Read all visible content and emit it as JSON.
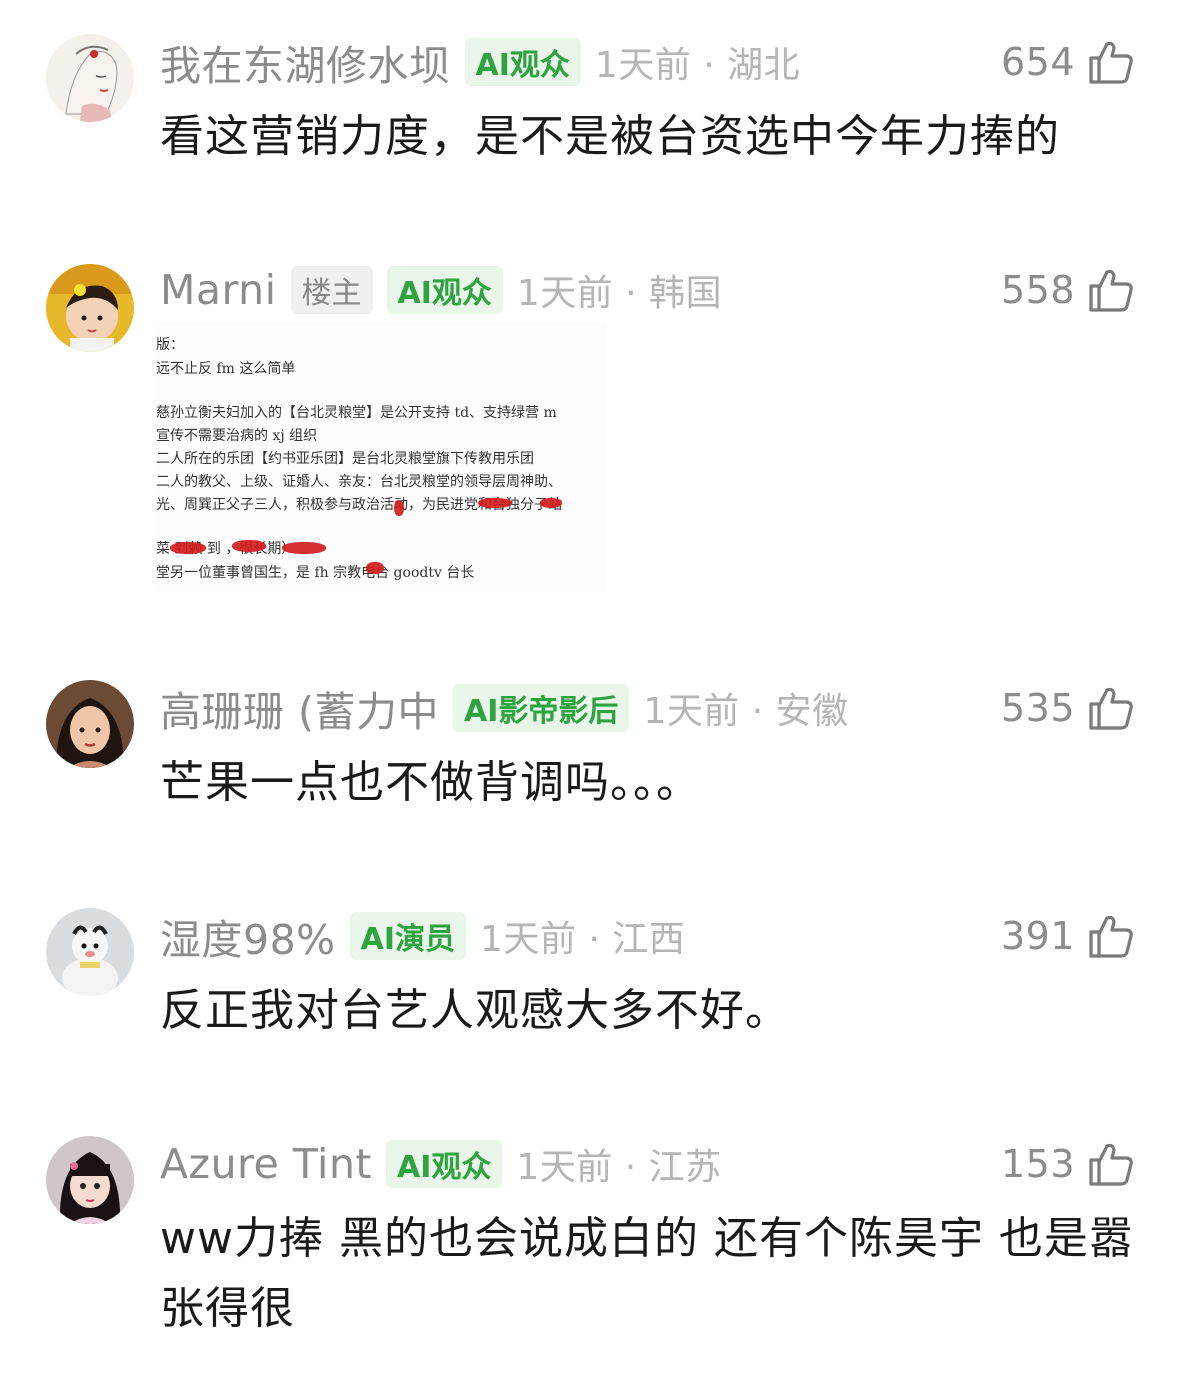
{
  "comments": [
    {
      "username": "我在东湖修水坝",
      "badges": [
        {
          "text": "AI观众",
          "type": "ai"
        }
      ],
      "time_location": "1天前 · 湖北",
      "likes": "654",
      "text": "看这营销力度，是不是被台资选中今年力捧的",
      "avatar": "avatar-sketch"
    },
    {
      "username": "Marni",
      "badges": [
        {
          "text": "楼主",
          "type": "host"
        },
        {
          "text": "AI观众",
          "type": "ai"
        }
      ],
      "time_location": "1天前 · 韩国",
      "likes": "558",
      "avatar": "avatar-child-yellow",
      "image_lines": [
        "版：",
        "远不止反 fm 这么简单",
        "慈孙立衡夫妇加入的【台北灵粮堂】是公开支持 td、支持绿营 m",
        "宣传不需要治病的 xj 组织",
        "二人所在的乐团【约书亚乐团】是台北灵粮堂旗下传教用乐团",
        "二人的教父、上级、证婚人、亲友：台北灵粮堂的领导层周神助、",
        "光、周巽正父子三人，积极参与政治活动，为民进党和台独分子站",
        "菜      到赖      到           ，很长期）",
        "堂另一位董事曾国生，是 fh 宗教电台 goodtv 台长"
      ]
    },
    {
      "username": "高珊珊 (蓄力中",
      "badges": [
        {
          "text": "AI影帝影后",
          "type": "ai"
        }
      ],
      "time_location": "1天前 · 安徽",
      "likes": "535",
      "text": "芒果一点也不做背调吗。。。",
      "avatar": "avatar-woman"
    },
    {
      "username": "湿度98%",
      "badges": [
        {
          "text": "AI演员",
          "type": "ai"
        }
      ],
      "time_location": "1天前 · 江西",
      "likes": "391",
      "text": "反正我对台艺人观感大多不好。",
      "avatar": "avatar-snowman"
    },
    {
      "username": "Azure Tint",
      "badges": [
        {
          "text": "AI观众",
          "type": "ai"
        }
      ],
      "time_location": "1天前 · 江苏",
      "likes": "153",
      "text": "ww力捧 黑的也会说成白的 还有个陈昊宇 也是嚣张得很",
      "avatar": "avatar-girl"
    }
  ],
  "colors": {
    "ai_badge_bg": "#eaf6e9",
    "ai_badge_text": "#2fa340",
    "meta_gray": "#8c8c8c",
    "time_gray": "#b5b5b5",
    "redaction": "#d2191a"
  },
  "icons": {
    "like": "thumbs-up-outline-icon"
  }
}
